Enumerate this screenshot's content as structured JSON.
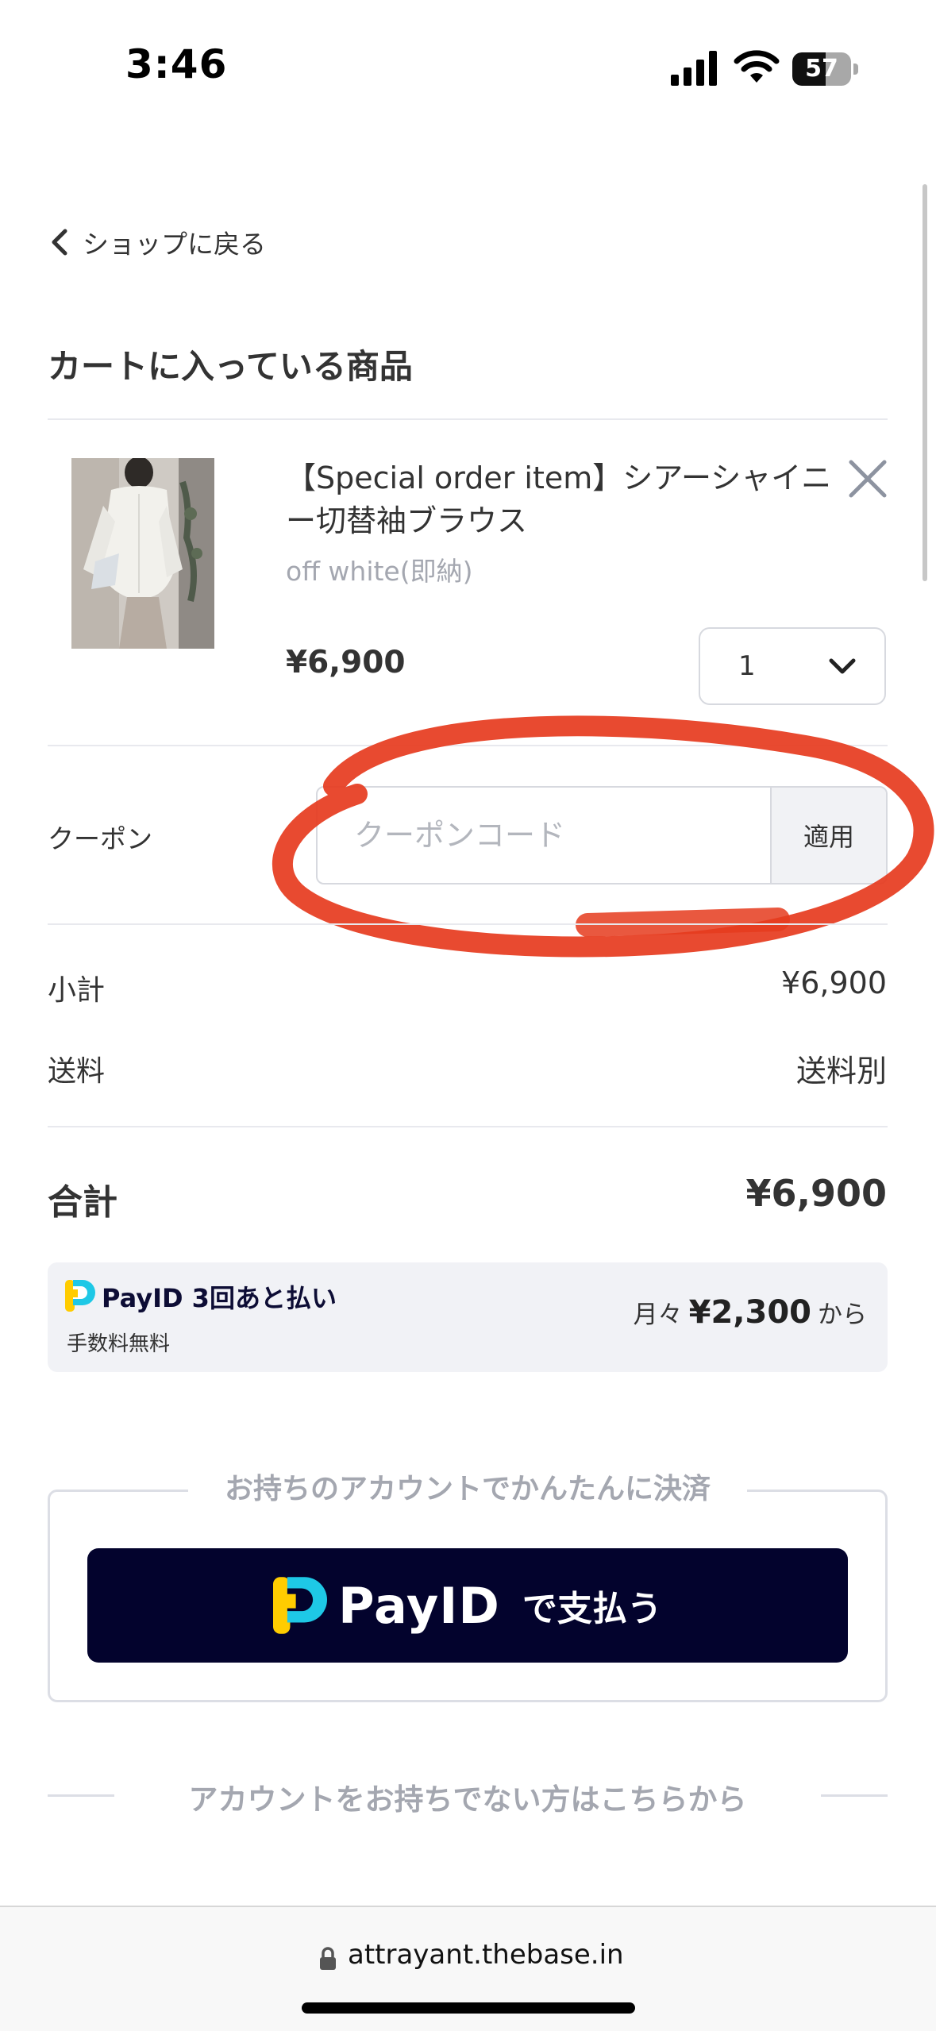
{
  "status_bar": {
    "time": "3:46",
    "battery": "57",
    "battery_level": 0.57
  },
  "nav": {
    "back_label": "ショップに戻る"
  },
  "cart": {
    "title": "カートに入っている商品",
    "item": {
      "name": "【Special order item】シアーシャイニー切替袖ブラウス",
      "variant": "off white(即納)",
      "price": "¥6,900",
      "quantity": "1"
    }
  },
  "coupon": {
    "label": "クーポン",
    "placeholder": "クーポンコード",
    "value": "",
    "apply_label": "適用"
  },
  "summary": {
    "subtotal_label": "小計",
    "subtotal_value": "¥6,900",
    "shipping_label": "送料",
    "shipping_value": "送料別",
    "total_label": "合計",
    "total_value": "¥6,900"
  },
  "payid_banner": {
    "title": "PayID 3回あと払い",
    "fee_note": "手数料無料",
    "monthly_prefix": "月々",
    "monthly_amount": "¥2,300",
    "monthly_suffix": "から"
  },
  "account": {
    "heading": "お持ちのアカウントでかんたんに決済",
    "button_brand": "PayID",
    "button_action": "で支払う",
    "guest_heading": "アカウントをお持ちでない方はこちらから"
  },
  "browser": {
    "url": "attrayant.thebase.in"
  },
  "colors": {
    "payid_navy": "#03032d",
    "payid_yellow": "#ffcc00",
    "payid_cyan": "#1ec8e6",
    "annotation_red": "#e63b1e",
    "muted_text": "#a4a7b0"
  },
  "icons": {
    "back": "chevron-left-icon",
    "remove": "close-icon",
    "quantity": "chevron-down-icon",
    "secure": "lock-icon",
    "payid": "payid-logo-icon"
  }
}
